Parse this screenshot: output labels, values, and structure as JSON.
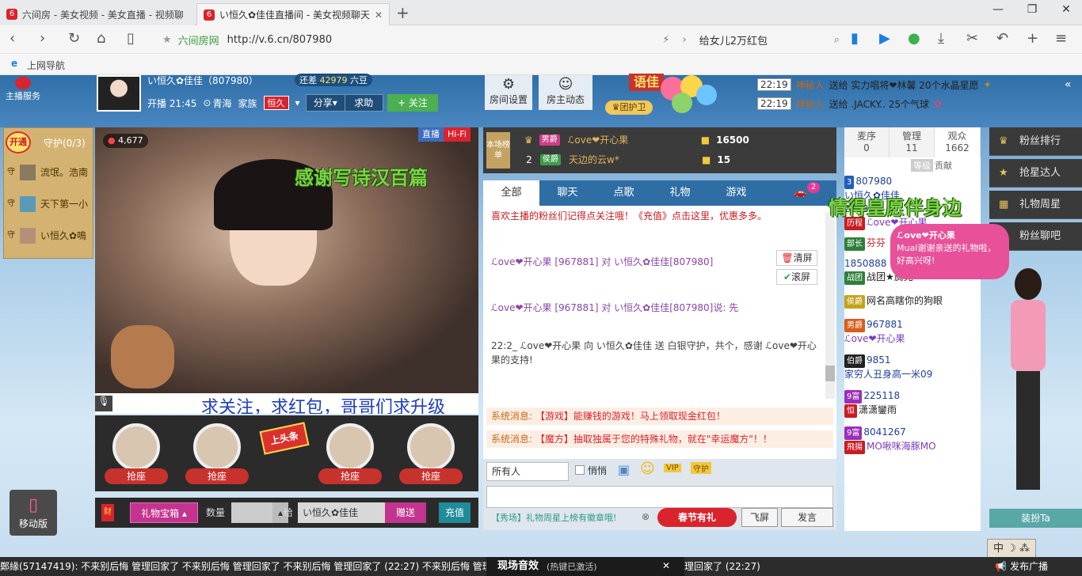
{
  "browser": {
    "tabs": [
      {
        "label": "六间房 - 美女视频 - 美女直播 - 视频聊"
      },
      {
        "label": "い恒久✿佳佳直播间 - 美女视频聊天"
      }
    ],
    "url_site": "六间房网",
    "url": "http://v.6.cn/807980",
    "search_text": "给女儿2万红包",
    "bookmark": "上网导航"
  },
  "header": {
    "service_label": "主播服务",
    "anchor_name": "い恒久✿佳佳（807980）",
    "level_gap_label": "还差",
    "level_gap_value": "42979",
    "level_gap_unit": "六豆",
    "start_time": "开播 21:45",
    "location": "青海",
    "family_label": "家族",
    "family_name": "恒久",
    "share": "分享",
    "help": "求助",
    "follow": "+ 关注",
    "room_settings": "房间设置",
    "anchor_news": "房主动态",
    "guard_group": "团护卫",
    "word_badge": "语佳",
    "feed": [
      {
        "time": "22:19",
        "user": "神秘人",
        "text": "送给 实力唱将❤林馨 20个水晶星愿"
      },
      {
        "time": "22:19",
        "user": "神秘人",
        "text": "送给 .JACKY.. 25个气球"
      }
    ]
  },
  "guard": {
    "open": "开通",
    "title": "守护(0/3)",
    "members": [
      {
        "name": "流氓。浩南"
      },
      {
        "name": "天下第一小"
      },
      {
        "name": "い恒久✿鳴"
      }
    ]
  },
  "video": {
    "wealth": "4,677",
    "live_label": "直播",
    "quality": "Hi-Fi",
    "thanks_overlay": "感谢写诗汉百篇",
    "scroll_text": "求关注，求红包，哥哥们求升级",
    "seats": [
      {
        "label": "抢座"
      },
      {
        "label": "抢座"
      },
      {
        "label": "抢座"
      },
      {
        "label": "抢座"
      }
    ],
    "headline_sign": "上头条"
  },
  "giftbar": {
    "gift_box": "礼物宝箱",
    "qty_label": "数量",
    "to_label": "给",
    "to_name": "い恒久✿佳佳",
    "send": "赠送",
    "recharge": "充值"
  },
  "rank": {
    "label": "本场榜单",
    "items": [
      {
        "rank": "1",
        "name": "ℒove❤开心果",
        "value": "16500"
      },
      {
        "rank": "2",
        "name": "天边的云w*",
        "value": "15"
      }
    ]
  },
  "chat": {
    "tabs": [
      {
        "label": "全部"
      },
      {
        "label": "聊天"
      },
      {
        "label": "点歌"
      },
      {
        "label": "礼物"
      },
      {
        "label": "游戏"
      }
    ],
    "car_badge": "2",
    "clear": "清屏",
    "scroll": "滚屏",
    "lines": [
      {
        "text": "喜欢主播的粉丝们记得点关注哦！《充值》点击这里，优惠多多。"
      },
      {
        "text": "ℒove❤开心果 [967881] 对 い恒久✿佳佳[807980]"
      },
      {
        "text": "ℒove❤开心果 [967881] 对 い恒久✿佳佳[807980]说: 先"
      },
      {
        "text": "22:2_  ℒove❤开心果 向 い恒久✿佳佳 送 白银守护，共个，感谢 ℒove❤开心果的支持!"
      }
    ],
    "sys": [
      {
        "prefix": "系统消息:",
        "text": "【游戏】能赚钱的游戏！马上领取现金红包！"
      },
      {
        "prefix": "系统消息:",
        "text": "【魔方】抽取独属于您的特殊礼物，就在\"幸运魔方\"！！"
      }
    ],
    "target": "所有人",
    "whisper": "悄悄",
    "vip_icon": "VIP",
    "guard_icon": "守护",
    "promo": "【秀场】礼物周星上榜有徽章哦!",
    "spring": "春节有礼",
    "fly": "飞屏",
    "send": "发言"
  },
  "users": {
    "tabs": [
      {
        "label": "麦序",
        "count": "0"
      },
      {
        "label": "管理",
        "count": "11"
      },
      {
        "label": "观众",
        "count": "1662"
      }
    ],
    "sort_level": "等级",
    "sort_contrib": "贡献",
    "rows": [
      {
        "badge": "3",
        "name": "807980"
      },
      {
        "badge": "",
        "name": "い恒久✿佳佳"
      },
      {
        "badge": "",
        "name": "2328"
      },
      {
        "badge": "历程",
        "name": "ℒove❤开心果"
      },
      {
        "badge": "部长",
        "name": "芬芬"
      },
      {
        "badge": "",
        "name": "1850888"
      },
      {
        "badge": "战团",
        "name": "战团★旖兜"
      },
      {
        "badge": "侯爵",
        "name": "网名高瞎你的狗眼"
      },
      {
        "badge": "男爵",
        "name": "967881"
      },
      {
        "badge": "",
        "name": "ℒove❤开心果"
      },
      {
        "badge": "伯爵",
        "name": "9851"
      },
      {
        "badge": "",
        "name": "家穷人丑身高一米09"
      },
      {
        "badge": "9富",
        "name": "225118"
      },
      {
        "badge": "恒",
        "name": "潇潇鑾雨"
      },
      {
        "badge": "9富",
        "name": "8041267"
      },
      {
        "badge": "飛揚",
        "name": "MO啾咪海豚MO"
      }
    ]
  },
  "right_menu": {
    "items": [
      {
        "label": "粉丝排行"
      },
      {
        "label": "抢星达人"
      },
      {
        "label": "礼物周星"
      },
      {
        "label": "粉丝聊吧"
      }
    ],
    "overlay": "情得皇愿伴身边",
    "bubble_user": "ℒove❤开心果",
    "bubble_text": "MuaI谢谢亲送的礼物啦，好高兴呀!",
    "dress_up": "装扮Ta"
  },
  "mobile": {
    "label": "移动版"
  },
  "bottom": {
    "ticker": "鄭緣(57147419): 不来别后悔 管理回家了 不来别后悔 管理回家了 不来别后悔 管理回家了 (22:27)  不来别后悔 管理回家了 不来别后悔 管理回家了 不来别后悔 管理回家了 (22:27)",
    "sound_label": "现场音效",
    "sound_sub": "(热键已激活)",
    "broadcast": "发布广播"
  },
  "colors": {
    "brand_red": "#d9232d",
    "chat_tab_blue": "#2f6ea5",
    "follow_green": "#4caf50"
  }
}
